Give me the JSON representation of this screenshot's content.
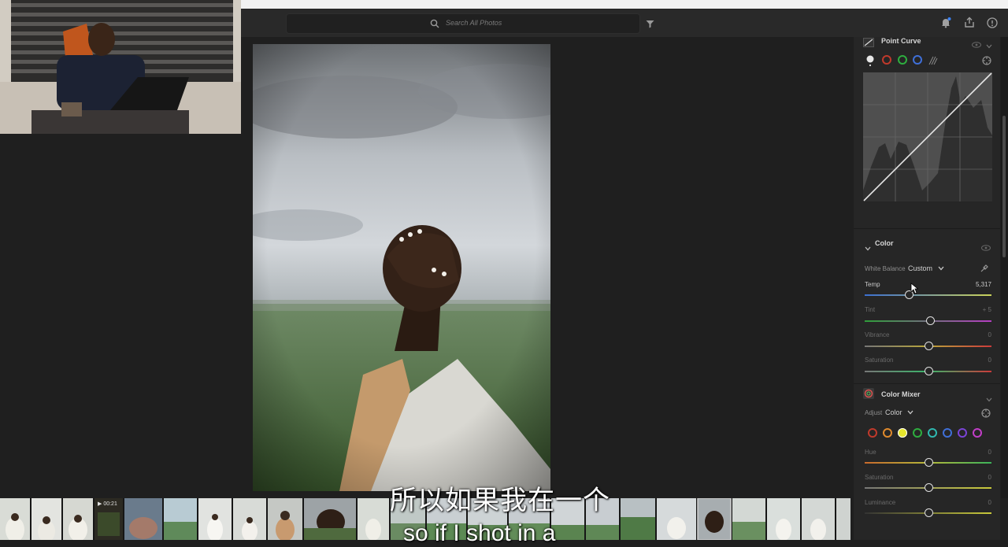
{
  "search": {
    "placeholder": "Search All Photos"
  },
  "panel": {
    "point_curve": {
      "title": "Point Curve"
    },
    "color": {
      "title": "Color",
      "white_balance_label": "White Balance",
      "white_balance_value": "Custom",
      "sliders": [
        {
          "label": "Temp",
          "value": "5,317"
        },
        {
          "label": "Tint",
          "value": "+ 5"
        },
        {
          "label": "Vibrance",
          "value": "0"
        },
        {
          "label": "Saturation",
          "value": "0"
        }
      ]
    },
    "color_mixer": {
      "title": "Color Mixer",
      "adjust_label": "Adjust",
      "adjust_value": "Color",
      "swatches": [
        "#c0392b",
        "#e08a2c",
        "#e6e62c",
        "#2eae3f",
        "#2fb8b0",
        "#3f6fd8",
        "#7a44d6",
        "#c23ec8"
      ],
      "sliders": [
        {
          "label": "Hue",
          "value": "0"
        },
        {
          "label": "Saturation",
          "value": "0"
        },
        {
          "label": "Luminance",
          "value": "0"
        }
      ]
    }
  },
  "filmstrip": {
    "video_duration": "00:21"
  },
  "subtitles": {
    "chinese": "所以如果我在一个",
    "english": "so if I shot in a"
  }
}
